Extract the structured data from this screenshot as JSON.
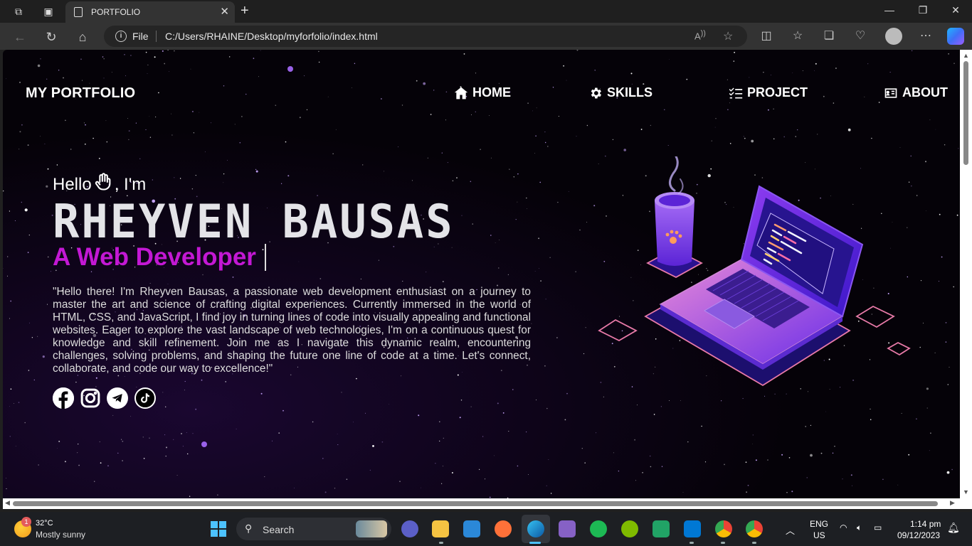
{
  "browser": {
    "tab_title": "PORTFOLIO",
    "url_label": "File",
    "url": "C:/Users/RHAINE/Desktop/myforfolio/index.html"
  },
  "page": {
    "logo": "MY PORTFOLIO",
    "nav": [
      {
        "label": "HOME",
        "icon": "home-icon"
      },
      {
        "label": "SKILLS",
        "icon": "gear-icon"
      },
      {
        "label": "PROJECT",
        "icon": "list-check-icon"
      },
      {
        "label": "ABOUT",
        "icon": "id-card-icon"
      }
    ],
    "hello_prefix": "Hello",
    "hello_suffix": ", I'm",
    "name": "RHEYVEN BAUSAS",
    "role": "A Web Developer",
    "bio": "\"Hello there! I'm Rheyven Bausas, a passionate web development enthusiast on a journey to master the art and science of crafting digital experiences. Currently immersed in the world of HTML, CSS, and JavaScript, I find joy in turning lines of code into visually appealing and functional websites. Eager to explore the vast landscape of web technologies, I'm on a continuous quest for knowledge and skill refinement. Join me as I navigate this dynamic realm, encountering challenges, solving problems, and shaping the future one line of code at a time. Let's connect, collaborate, and code our way to excellence!\"",
    "social": [
      "facebook-icon",
      "instagram-icon",
      "telegram-icon",
      "tiktok-icon"
    ],
    "accent_color": "#c318d4"
  },
  "taskbar": {
    "weather_badge": "1",
    "temperature": "32°C",
    "condition": "Mostly sunny",
    "search_label": "Search",
    "lang_top": "ENG",
    "lang_bottom": "US",
    "time": "1:14 pm",
    "date": "09/12/2023"
  }
}
